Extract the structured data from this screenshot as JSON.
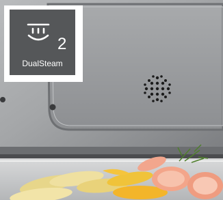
{
  "badge": {
    "icon": "steam-injection-icon",
    "number": "2",
    "label": "DualSteam"
  },
  "colors": {
    "badge_background": "#555759",
    "badge_frame": "#ffffff",
    "badge_text": "#ffffff",
    "oven_metal": "#9a9c9e",
    "oven_vent_holes": "#1c1c1c"
  }
}
